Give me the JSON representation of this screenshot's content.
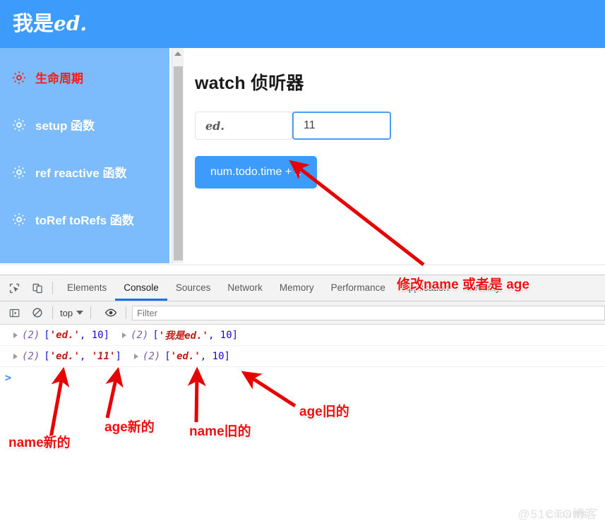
{
  "app": {
    "header": {
      "title_cjk": "我是",
      "title_latin": "ed."
    },
    "sidebar": {
      "items": [
        {
          "icon": "gear-icon",
          "label": "生命周期",
          "active": true
        },
        {
          "icon": "gear-icon",
          "label": "setup 函数",
          "active": false
        },
        {
          "icon": "gear-icon",
          "label": "ref reactive 函数",
          "active": false
        },
        {
          "icon": "gear-icon",
          "label": "toRef toRefs 函数",
          "active": false
        }
      ]
    },
    "main": {
      "heading": "watch 侦听器",
      "name_input_value": "ed.",
      "age_input_value": "11",
      "button_label": "num.todo.time + 1"
    },
    "colors": {
      "brand_blue": "#3d9bfb",
      "sidebar_blue": "#7cbcfc",
      "active_red": "#ff1a1a",
      "focus_blue": "#4d9df6"
    }
  },
  "devtools": {
    "tabs": [
      {
        "label": "Elements",
        "selected": false
      },
      {
        "label": "Console",
        "selected": true
      },
      {
        "label": "Sources",
        "selected": false
      },
      {
        "label": "Network",
        "selected": false
      },
      {
        "label": "Memory",
        "selected": false
      },
      {
        "label": "Performance",
        "selected": false
      },
      {
        "label": "Application",
        "selected": false
      },
      {
        "label": "Security",
        "selected": false
      }
    ],
    "icons": {
      "inspect": "inspect-element-icon",
      "device": "device-toolbar-icon",
      "sidebar": "console-sidebar-icon",
      "clear": "clear-console-icon",
      "eye": "live-expression-icon"
    },
    "toolbar": {
      "context_label": "top",
      "filter_placeholder": "Filter"
    },
    "console": {
      "lines": [
        {
          "groups": [
            {
              "count": "(2)",
              "items": [
                {
                  "type": "string",
                  "text": "'ed.'"
                },
                {
                  "type": "number",
                  "text": "10"
                }
              ]
            },
            {
              "count": "(2)",
              "items": [
                {
                  "type": "string",
                  "text": "'我是ed.'"
                },
                {
                  "type": "number",
                  "text": "10"
                }
              ]
            }
          ]
        },
        {
          "groups": [
            {
              "count": "(2)",
              "items": [
                {
                  "type": "string",
                  "text": "'ed.'"
                },
                {
                  "type": "string",
                  "text": "'11'"
                }
              ]
            },
            {
              "count": "(2)",
              "items": [
                {
                  "type": "string",
                  "text": "'ed.'"
                },
                {
                  "type": "number",
                  "text": "10"
                }
              ]
            }
          ]
        }
      ],
      "prompt_chevron": ">"
    }
  },
  "annotations": {
    "tabbar_note": "修改name 或者是 age",
    "tabbar_note_part1": "修改",
    "tabbar_note_name": "name",
    "tabbar_note_mid": " 或者是 ",
    "tabbar_note_age": "age",
    "name_new": "name新的",
    "age_new": "age新的",
    "name_old": "name旧的",
    "age_old": "age旧的"
  },
  "watermark": {
    "main": "@51CTO博客",
    "sub": "CSDN博客"
  }
}
